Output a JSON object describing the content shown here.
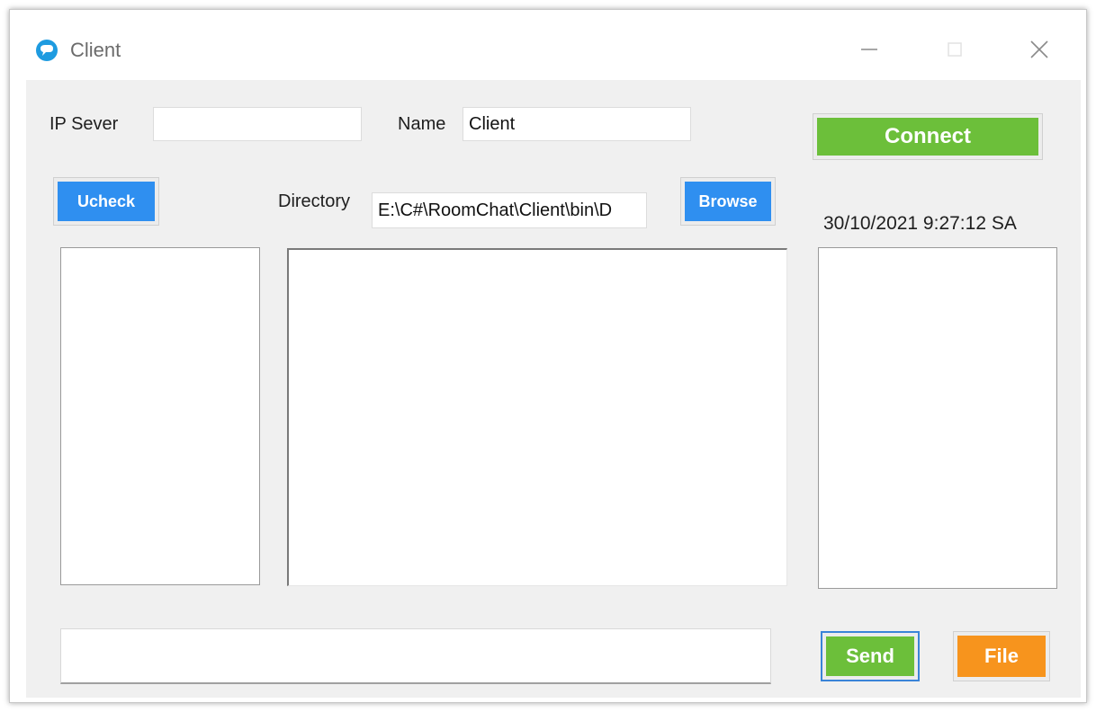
{
  "window": {
    "title": "Client"
  },
  "form": {
    "ip_label": "IP Sever",
    "ip_value": "",
    "name_label": "Name",
    "name_value": "Client",
    "directory_label": "Directory",
    "directory_value": "E:\\C#\\RoomChat\\Client\\bin\\D",
    "timestamp": "30/10/2021 9:27:12 SA",
    "message_value": ""
  },
  "buttons": {
    "connect": "Connect",
    "ucheck": "Ucheck",
    "browse": "Browse",
    "send": "Send",
    "file": "File"
  },
  "colors": {
    "connect": "#6cbf3a",
    "ucheck": "#2f8ff0",
    "browse": "#2f8ff0",
    "send": "#6cbf3a",
    "file": "#f7941d",
    "client_area": "#f0f0f0"
  },
  "icons": {
    "app": "chat-bubble-icon",
    "minimize": "minimize-icon",
    "maximize": "maximize-icon",
    "close": "close-icon"
  }
}
